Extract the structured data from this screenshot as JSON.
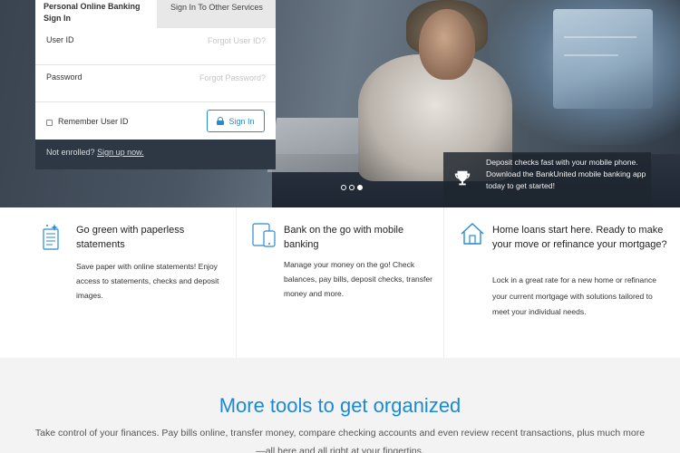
{
  "login": {
    "tab_active": "Personal Online Banking Sign In",
    "tab_other": "Sign In To Other Services",
    "user_id_label": "User ID",
    "forgot_user_id": "Forgot User ID?",
    "password_label": "Password",
    "forgot_password": "Forgot Password?",
    "remember_label": "Remember User ID",
    "signin_label": "Sign In",
    "not_enrolled": "Not enrolled?",
    "signup_link": "Sign up now."
  },
  "hero": {
    "promo_text": "Deposit checks fast with your mobile phone. Download the BankUnited mobile banking app today to get started!",
    "promo_icon": "trophy-icon",
    "slide_count": 3,
    "active_slide": 3
  },
  "features": [
    {
      "icon": "paper-statement-icon",
      "title": "Go green with paperless statements",
      "body": "Save paper with online statements! Enjoy access to statements, checks and deposit images."
    },
    {
      "icon": "mobile-device-icon",
      "title": "Bank on the go with mobile banking",
      "body": "Manage your money on the go! Check balances, pay bills, deposit checks, transfer money and more."
    },
    {
      "icon": "house-icon",
      "title": "Home loans start here. Ready to make your move or refinance your mortgage?",
      "body": "Lock in a great rate for a new home or refinance your current mortgage with solutions tailored to meet your individual needs."
    }
  ],
  "tools": {
    "heading": "More tools to get organized",
    "body": "Take control of your finances. Pay bills online, transfer money, compare checking accounts and even review recent transactions, plus much more—all here and all right at your fingertips."
  },
  "colors": {
    "accent": "#1b8ad0",
    "login_footer": "#2e3845"
  }
}
